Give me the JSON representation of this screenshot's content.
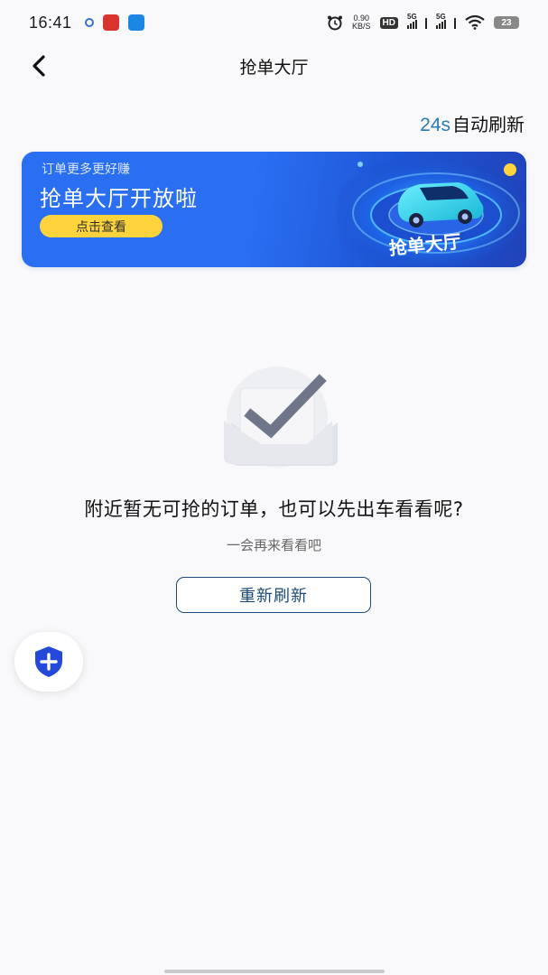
{
  "status_bar": {
    "time": "16:41",
    "net_speed_value": "0.90",
    "net_speed_unit": "KB/S",
    "hd_label": "HD",
    "signal1_label": "5G",
    "signal2_label": "5G",
    "battery": "23"
  },
  "nav": {
    "title": "抢单大厅"
  },
  "refresh": {
    "seconds": "24s",
    "label": "自动刷新"
  },
  "banner": {
    "subtitle": "订单更多更好赚",
    "title": "抢单大厅开放啦",
    "button_label": "点击查看",
    "art_caption": "抢单大厅"
  },
  "empty_state": {
    "title": "附近暂无可抢的订单，也可以先出车看看呢?",
    "subtitle": "一会再来看看吧",
    "refresh_button_label": "重新刷新"
  },
  "colors": {
    "accent_blue": "#2a7cb3",
    "banner_blue": "#2a6ef1",
    "banner_button_yellow": "#ffd33c",
    "refresh_border": "#1d4a7a",
    "shield_blue": "#2448d8"
  }
}
